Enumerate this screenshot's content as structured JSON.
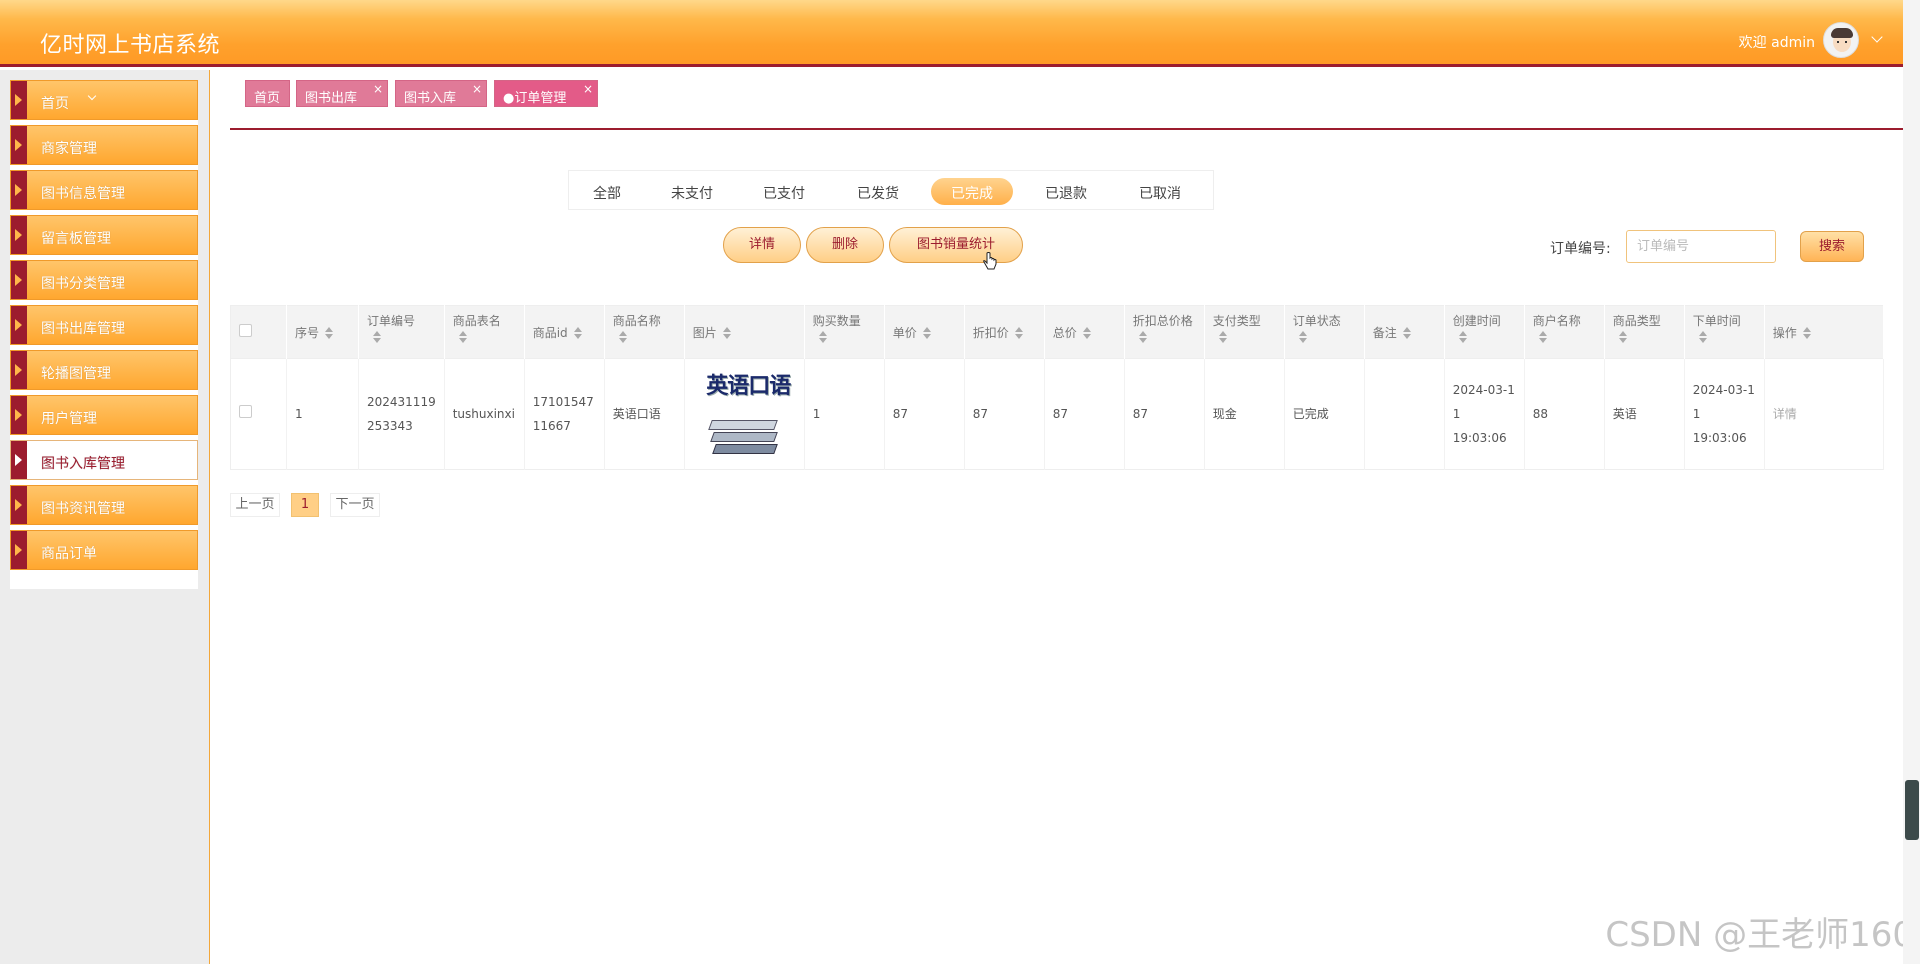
{
  "header": {
    "title": "亿时网上书店系统",
    "welcome": "欢迎 admin"
  },
  "sidebar": {
    "items": [
      {
        "label": "首页"
      },
      {
        "label": "商家管理"
      },
      {
        "label": "图书信息管理"
      },
      {
        "label": "留言板管理"
      },
      {
        "label": "图书分类管理"
      },
      {
        "label": "图书出库管理"
      },
      {
        "label": "轮播图管理"
      },
      {
        "label": "用户管理"
      },
      {
        "label": "图书入库管理"
      },
      {
        "label": "图书资讯管理"
      },
      {
        "label": "商品订单"
      }
    ]
  },
  "tabs": [
    {
      "label": "首页"
    },
    {
      "label": "图书出库"
    },
    {
      "label": "图书入库"
    },
    {
      "label": "●订单管理"
    }
  ],
  "status_filters": [
    "全部",
    "未支付",
    "已支付",
    "已发货",
    "已完成",
    "已退款",
    "已取消"
  ],
  "actions": {
    "detail": "详情",
    "delete": "删除",
    "stats": "图书销量统计"
  },
  "search": {
    "label": "订单编号:",
    "placeholder": "订单编号",
    "button": "搜索"
  },
  "table": {
    "headers": [
      "序号",
      "订单编号",
      "商品表名",
      "商品id",
      "商品名称",
      "图片",
      "购买数量",
      "单价",
      "折扣价",
      "总价",
      "折扣总价格",
      "支付类型",
      "订单状态",
      "备注",
      "创建时间",
      "商户名称",
      "商品类型",
      "下单时间",
      "操作"
    ],
    "rows": [
      {
        "index": "1",
        "order_no_1": "202431119",
        "order_no_2": "253343",
        "table_name": "tushuxinxi",
        "goods_id_1": "17101547",
        "goods_id_2": "11667",
        "goods_name": "英语口语",
        "image_text": "英语口语",
        "quantity": "1",
        "price": "87",
        "discount_price": "87",
        "total": "87",
        "discount_total": "87",
        "pay_type": "现金",
        "status": "已完成",
        "remark": "",
        "created_1": "2024-03-1",
        "created_2": "1 19:03:06",
        "merchant": "88",
        "goods_type": "英语",
        "order_time_1": "2024-03-1",
        "order_time_2": "1 19:03:06",
        "op": "详情"
      }
    ]
  },
  "pager": {
    "prev": "上一页",
    "current": "1",
    "next": "下一页"
  },
  "watermark": "CSDN @王老师160",
  "colors": {
    "accent": "#ffa12c",
    "brand": "#9c1c2e",
    "tab": "#e07a98"
  }
}
